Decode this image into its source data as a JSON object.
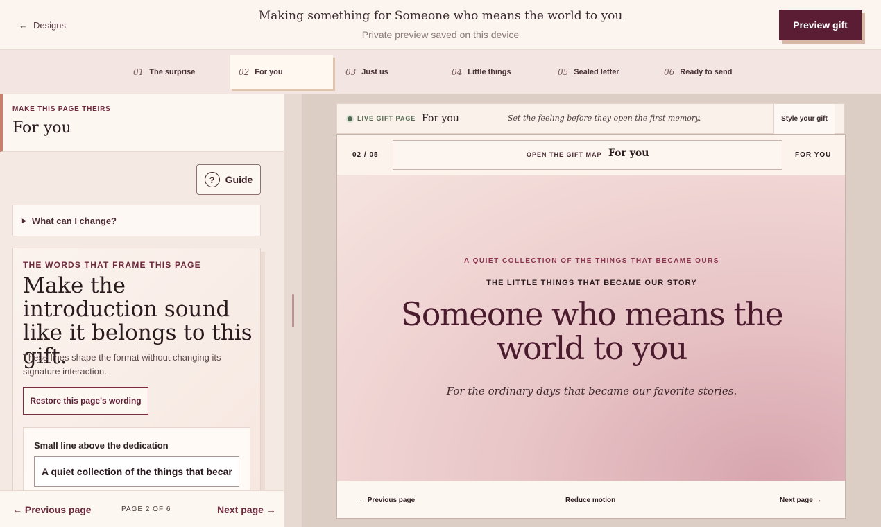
{
  "header": {
    "back_label": "Designs",
    "back_arrow": "←",
    "title": "Making something for Someone who means the world to you",
    "subtitle": "Private preview saved on this device",
    "preview_button": "Preview gift"
  },
  "steps": [
    {
      "num": "01",
      "label": "The surprise"
    },
    {
      "num": "02",
      "label": "For you",
      "active": true
    },
    {
      "num": "03",
      "label": "Just us"
    },
    {
      "num": "04",
      "label": "Little things"
    },
    {
      "num": "05",
      "label": "Sealed letter"
    },
    {
      "num": "06",
      "label": "Ready to send"
    }
  ],
  "left_panel": {
    "eyebrow": "MAKE THIS PAGE THEIRS",
    "title": "For you",
    "guide_icon": "?",
    "guide_label": "Guide",
    "details_label": "What can I change?",
    "card": {
      "eyebrow": "THE WORDS THAT FRAME THIS PAGE",
      "heading": "Make the introduction sound like it belongs to this gift.",
      "description": "These lines shape the format without changing its signature interaction.",
      "restore_button": "Restore this page's wording",
      "field_label": "Small line above the dedication",
      "field_value": "A quiet collection of the things that became ours"
    },
    "footer": {
      "prev": "← Previous page",
      "page_count": "PAGE 2 OF 6",
      "next": "Next page →"
    }
  },
  "live_bar": {
    "tag": "LIVE GIFT PAGE",
    "title": "For you",
    "hint": "Set the feeling before they open the first memory.",
    "style_button": "Style your gift"
  },
  "gift": {
    "counter": "02 / 05",
    "map_label": "OPEN THE GIFT MAP",
    "map_title": "For you",
    "right_label": "FOR YOU",
    "eyebrow": "A QUIET COLLECTION OF THE THINGS THAT BECAME OURS",
    "subheading": "THE LITTLE THINGS THAT BECAME OUR STORY",
    "heading": "Someone who means the world to you",
    "tagline": "For the ordinary days that became our favorite stories.",
    "footer": {
      "prev": "← Previous page",
      "motion": "Reduce motion",
      "next": "Next page →"
    }
  },
  "colors": {
    "accent": "#5b1d33",
    "eyebrow": "#6d2a3c",
    "live": "#556b56"
  }
}
